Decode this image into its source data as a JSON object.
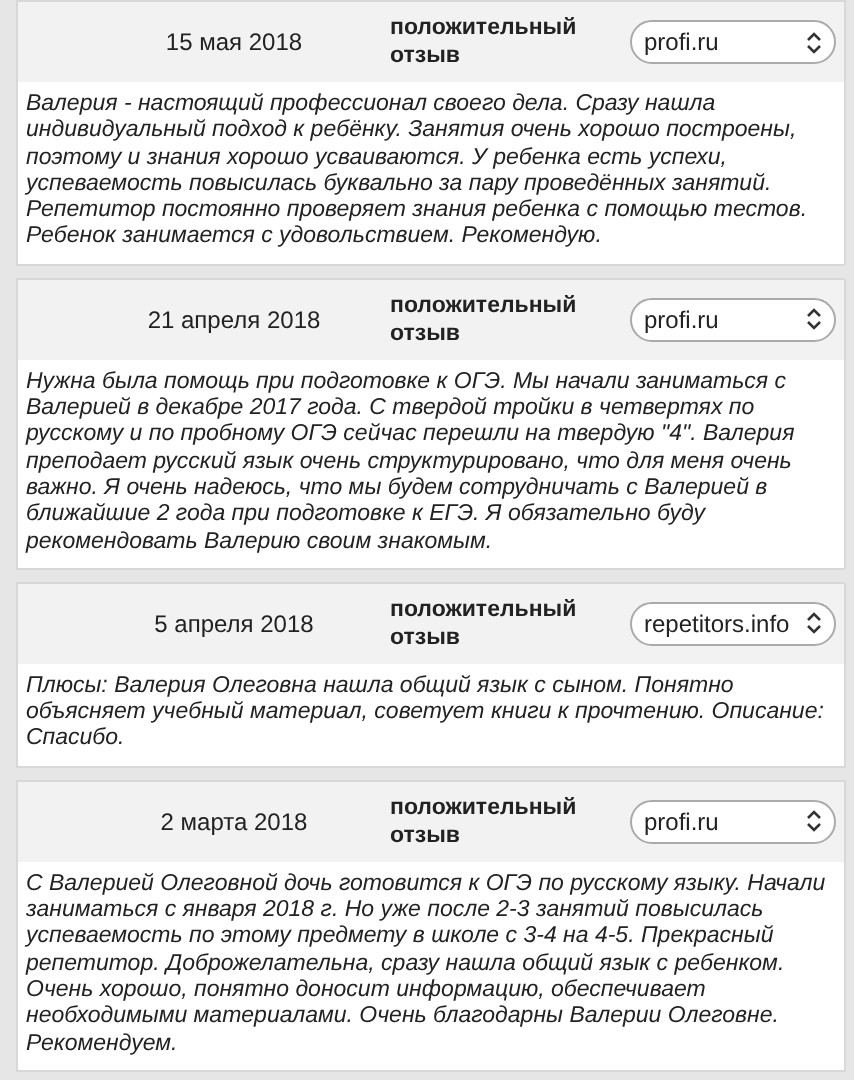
{
  "reviews": [
    {
      "date": "15 мая 2018",
      "verdict": "положительный отзыв",
      "source": "profi.ru",
      "text": "Валерия - настоящий профессионал своего дела. Сразу нашла индивидуальный подход к ребёнку. Занятия очень хорошо построены, поэтому и знания хорошо усваиваются. У ребенка есть успехи, успеваемость повысилась буквально за пару проведённых занятий. Репетитор постоянно проверяет знания ребенка с помощью тестов. Ребенок занимается с удовольствием. Рекомендую."
    },
    {
      "date": "21 апреля 2018",
      "verdict": "положительный отзыв",
      "source": "profi.ru",
      "text": "Нужна была помощь при подготовке к ОГЭ. Мы начали заниматься с Валерией в декабре 2017 года. С твердой тройки в четвертях по русскому и по пробному ОГЭ сейчас перешли на твердую \"4\". Валерия преподает русский язык очень структурировано, что для меня очень важно. Я очень надеюсь, что мы будем сотрудничать с Валерией в ближайшие 2 года при подготовке к ЕГЭ. Я обязательно буду рекомендовать Валерию своим знакомым."
    },
    {
      "date": "5 апреля 2018",
      "verdict": "положительный отзыв",
      "source": "repetitors.info",
      "text": "Плюсы: Валерия Олеговна нашла общий язык с сыном. Понятно объясняет учебный материал, советует книги к прочтению. Описание: Спасибо."
    },
    {
      "date": "2 марта 2018",
      "verdict": "положительный отзыв",
      "source": "profi.ru",
      "text": "С Валерией Олеговной дочь готовится к ОГЭ по русскому языку. Начали заниматься с января 2018 г. Но уже после 2-3 занятий повысилась успеваемость по этому предмету в школе с 3-4 на 4-5. Прекрасный репетитор. Доброжелательна, сразу нашла общий язык с ребенком. Очень хорошо, понятно доносит информацию, обеспечивает необходимыми материалами. Очень благодарны Валерии Олеговне. Рекомендуем."
    }
  ]
}
